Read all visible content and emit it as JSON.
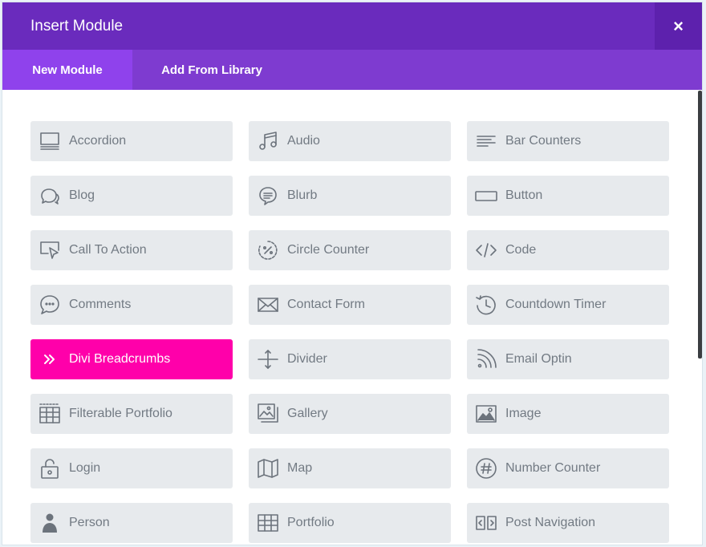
{
  "header": {
    "title": "Insert Module",
    "close_label": "×"
  },
  "tabs": [
    {
      "label": "New Module",
      "active": true
    },
    {
      "label": "Add From Library",
      "active": false
    }
  ],
  "colors": {
    "header": "#6a2bbd",
    "tab_bar": "#7e3bd0",
    "tab_active": "#8f42ec",
    "module_bg": "#e7eaed",
    "module_text": "#727a83",
    "selected": "#ff00aa"
  },
  "modules": [
    {
      "label": "Accordion",
      "icon": "accordion-icon"
    },
    {
      "label": "Audio",
      "icon": "music-note-icon"
    },
    {
      "label": "Bar Counters",
      "icon": "bar-counters-icon"
    },
    {
      "label": "Blog",
      "icon": "speech-bubbles-icon"
    },
    {
      "label": "Blurb",
      "icon": "blurb-icon"
    },
    {
      "label": "Button",
      "icon": "button-icon"
    },
    {
      "label": "Call To Action",
      "icon": "cursor-window-icon"
    },
    {
      "label": "Circle Counter",
      "icon": "circle-percent-icon"
    },
    {
      "label": "Code",
      "icon": "code-icon"
    },
    {
      "label": "Comments",
      "icon": "comment-bubble-icon"
    },
    {
      "label": "Contact Form",
      "icon": "envelope-icon"
    },
    {
      "label": "Countdown Timer",
      "icon": "clock-icon"
    },
    {
      "label": "Divi Breadcrumbs",
      "icon": "double-chevron-icon",
      "selected": true
    },
    {
      "label": "Divider",
      "icon": "divider-icon"
    },
    {
      "label": "Email Optin",
      "icon": "rss-icon"
    },
    {
      "label": "Filterable Portfolio",
      "icon": "filter-grid-icon"
    },
    {
      "label": "Gallery",
      "icon": "gallery-icon"
    },
    {
      "label": "Image",
      "icon": "image-icon"
    },
    {
      "label": "Login",
      "icon": "lock-icon"
    },
    {
      "label": "Map",
      "icon": "map-icon"
    },
    {
      "label": "Number Counter",
      "icon": "hash-icon"
    },
    {
      "label": "Person",
      "icon": "person-icon"
    },
    {
      "label": "Portfolio",
      "icon": "grid-icon"
    },
    {
      "label": "Post Navigation",
      "icon": "post-navigation-icon"
    }
  ]
}
